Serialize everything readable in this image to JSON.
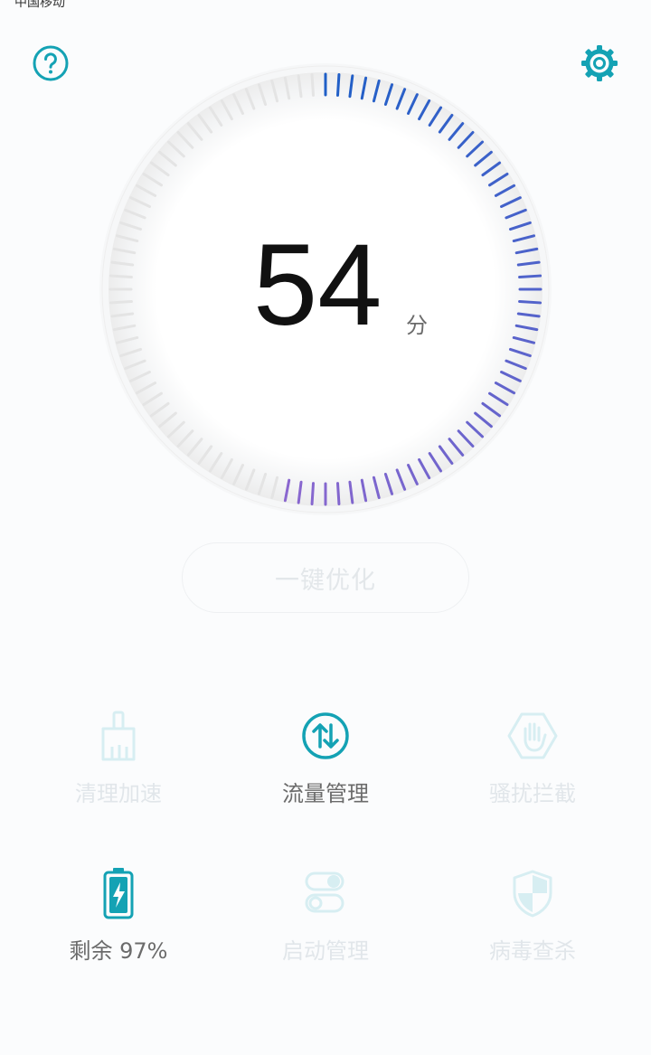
{
  "status": {
    "carrier": "中国移动"
  },
  "header": {
    "help_icon": "help-circle-icon",
    "settings_icon": "gear-icon"
  },
  "score": {
    "value": "54",
    "unit": "分",
    "progress_fraction": 0.54
  },
  "colors": {
    "accent": "#14a2b4",
    "gauge_start": "#1f5fc7",
    "gauge_end": "#8a67cf",
    "track": "#e4e4e4",
    "dim_text": "#e1e6ea"
  },
  "actions": {
    "optimize_label": "一键优化"
  },
  "tools": [
    {
      "label": "清理加速",
      "icon": "broom-icon",
      "active": false
    },
    {
      "label": "流量管理",
      "icon": "data-traffic-icon",
      "active": true
    },
    {
      "label": "骚扰拦截",
      "icon": "block-hand-icon",
      "active": false
    },
    {
      "label": "剩余 97%",
      "icon": "battery-icon",
      "active": true
    },
    {
      "label": "启动管理",
      "icon": "startup-toggle-icon",
      "active": false
    },
    {
      "label": "病毒查杀",
      "icon": "shield-icon",
      "active": false
    }
  ]
}
